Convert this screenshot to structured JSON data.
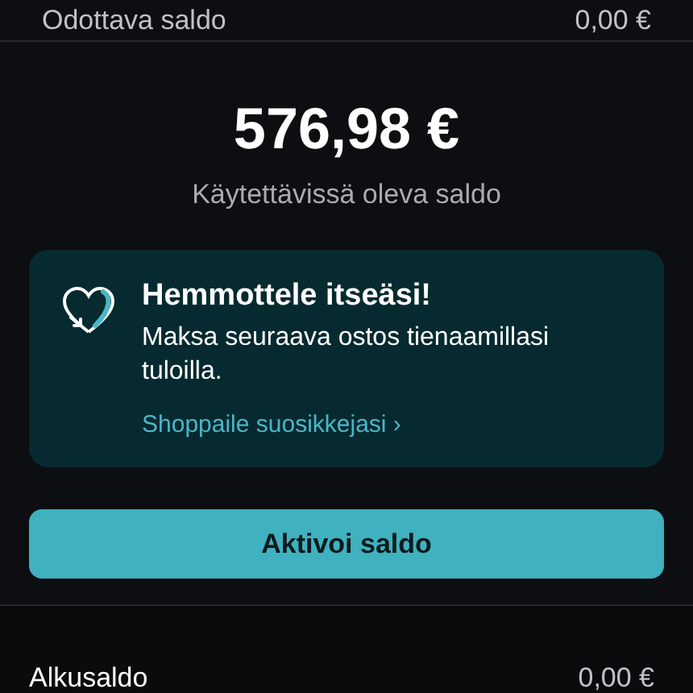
{
  "pending_row": {
    "label": "Odottava saldo",
    "value": "0,00 €"
  },
  "balance": {
    "amount": "576,98 €",
    "caption": "Käytettävissä oleva saldo"
  },
  "promo": {
    "title": "Hemmottele itseäsi!",
    "text": "Maksa seuraava ostos tienaamillasi tuloilla.",
    "link": "Shoppaile suosikkejasi",
    "link_chevron": "›"
  },
  "activate_button": "Aktivoi saldo",
  "start_row": {
    "label": "Alkusaldo",
    "value": "0,00 €"
  }
}
